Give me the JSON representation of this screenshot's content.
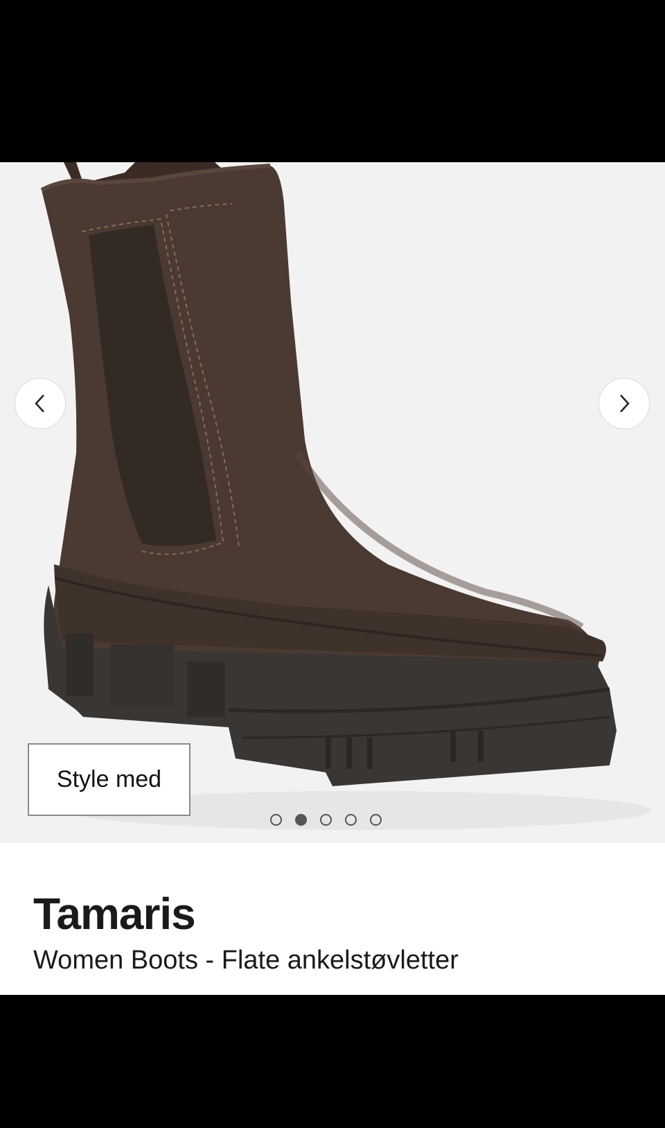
{
  "gallery": {
    "prev_label": "Previous image",
    "next_label": "Next image",
    "style_button": "Style med",
    "image_count": 5,
    "active_index": 1,
    "background": "#f2f2f2",
    "image_icon": "product-boot-image"
  },
  "product": {
    "brand": "Tamaris",
    "name": "Women Boots - Flate ankelstøvletter"
  },
  "colors": {
    "boot_leather": "#4a3a32",
    "elastic_panel": "#332a23",
    "sole": "#3a3633",
    "text": "#1a1a1a"
  }
}
